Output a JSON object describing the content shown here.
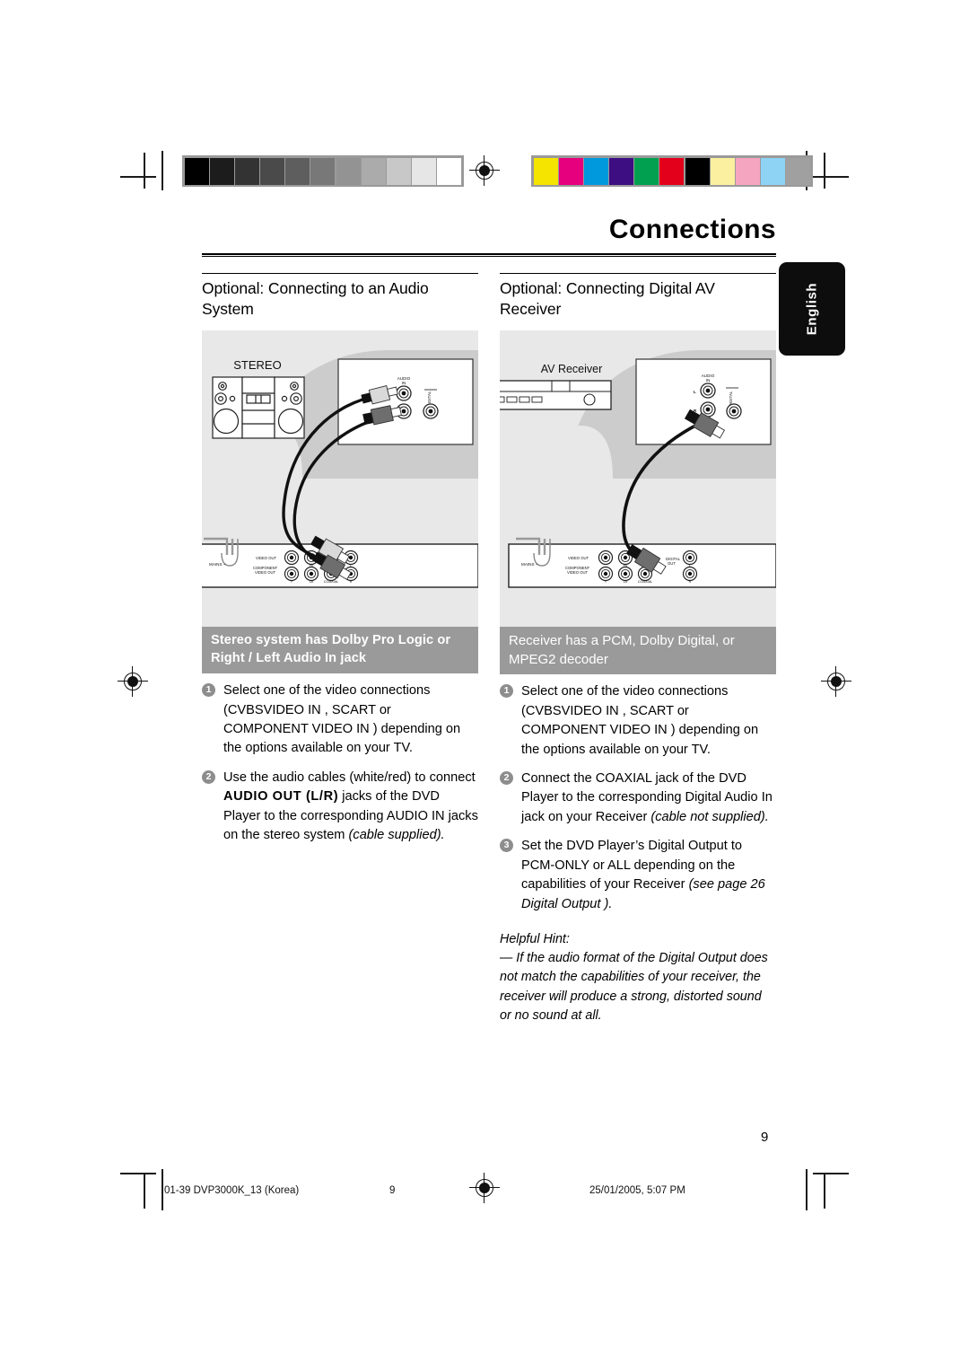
{
  "document": {
    "page_title": "Connections",
    "page_number": "9",
    "language_tab": "English"
  },
  "columns": [
    {
      "heading": "Optional: Connecting to an Audio System",
      "figure": {
        "device_label": "STEREO",
        "jack_labels": [
          "AUDIO",
          "IN",
          "DIGITAL"
        ],
        "player_labels": [
          "MAINS ~",
          "VIDEO OUT",
          "COMPONENT VIDEO OUT",
          "Pb",
          "Pr",
          "Y",
          "Cb",
          "COAXIAL",
          "L",
          "R"
        ]
      },
      "banner": "Stereo system has Dolby Pro Logic or Right / Left Audio In jack",
      "banner_bold": true,
      "steps": [
        {
          "num": "1",
          "parts": [
            {
              "t": "Select one of the video connections (CVBSVIDEO IN , SCART or COMPONENT VIDEO IN ) depending on the options available on your TV.",
              "s": "n"
            }
          ]
        },
        {
          "num": "2",
          "parts": [
            {
              "t": "Use the audio cables (white/red) to connect ",
              "s": "n"
            },
            {
              "t": "AUDIO OUT (L/R)",
              "s": "b"
            },
            {
              "t": " jacks of the DVD Player to the corresponding AUDIO IN jacks on the stereo system ",
              "s": "n"
            },
            {
              "t": "(cable supplied).",
              "s": "i"
            }
          ]
        }
      ],
      "hint": null
    },
    {
      "heading": "Optional: Connecting Digital AV Receiver",
      "figure": {
        "device_label": "AV Receiver",
        "jack_labels": [
          "AUDIO",
          "IN",
          "L",
          "R",
          "DIGITAL"
        ],
        "player_labels": [
          "MAINS ~",
          "VIDEO OUT",
          "COMPONENT VIDEO OUT",
          "DIGITAL OUT",
          "Pb",
          "Pr",
          "Y",
          "Cb",
          "COAXIAL",
          "L",
          "R"
        ]
      },
      "banner": "Receiver has a PCM, Dolby Digital, or MPEG2 decoder",
      "banner_bold": false,
      "steps": [
        {
          "num": "1",
          "parts": [
            {
              "t": "Select one of the video connections (CVBSVIDEO IN , SCART or COMPONENT VIDEO IN ) depending on the options available on your TV.",
              "s": "n"
            }
          ]
        },
        {
          "num": "2",
          "parts": [
            {
              "t": "Connect the COAXIAL jack of the DVD Player to the corresponding Digital Audio In jack on your Receiver ",
              "s": "n"
            },
            {
              "t": "(cable not supplied).",
              "s": "i"
            }
          ]
        },
        {
          "num": "3",
          "parts": [
            {
              "t": "Set the DVD Player’s Digital Output to PCM-ONLY or ALL depending on the capabilities of your Receiver ",
              "s": "n"
            },
            {
              "t": "(see page 26 Digital Output ).",
              "s": "i"
            }
          ]
        }
      ],
      "hint": {
        "title": "Helpful Hint:",
        "body": "—  If the audio format of the Digital Output does not match the capabilities of your receiver, the receiver will produce a strong, distorted sound or no sound at all."
      }
    }
  ],
  "print_footer": {
    "file": "01-39 DVP3000K_13 (Korea)",
    "page": "9",
    "date": "25/01/2005, 5:07 PM"
  },
  "calibration": {
    "grayscale": [
      "#000000",
      "#1c1c1c",
      "#333333",
      "#4a4a4a",
      "#5e5e5e",
      "#787878",
      "#939393",
      "#ababab",
      "#c8c8c8",
      "#e6e6e6",
      "#ffffff"
    ],
    "colors": [
      "#f5e400",
      "#e6007e",
      "#0099dd",
      "#3d0d82",
      "#00a050",
      "#e3001b",
      "#000000",
      "#faf0a0",
      "#f6a5c0",
      "#8fd3f4",
      "#a0a0a0"
    ]
  }
}
